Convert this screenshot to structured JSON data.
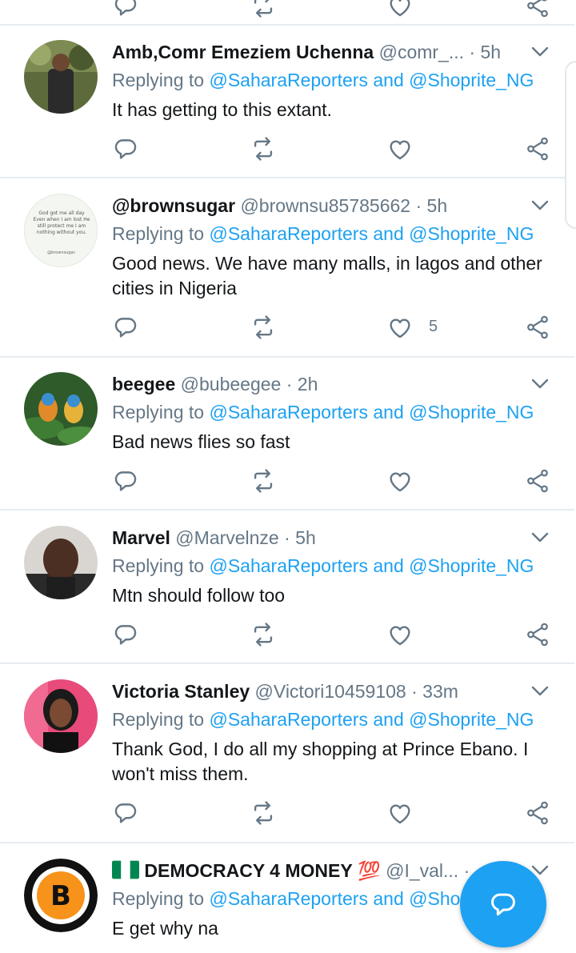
{
  "reply_prefix": "Replying to",
  "and_word": "and",
  "tweets": [
    {
      "name": "Amb,Comr Emeziem Uchenna",
      "handle": "@comr_...",
      "time": "5h",
      "mention1": "@SaharaReporters",
      "mention2": "@Shoprite_NG",
      "text": "It has getting  to this extant.",
      "like_count": ""
    },
    {
      "name": "@brownsugar",
      "handle": "@brownsu85785662",
      "time": "5h",
      "mention1": "@SaharaReporters",
      "mention2": "@Shoprite_NG",
      "text": "Good news.  We have many malls, in lagos and other cities in Nigeria",
      "like_count": "5",
      "avatar_text": "God got me all day Even when I am lost He still protect me I am nothing without you.",
      "avatar_signature": "@brownsugar."
    },
    {
      "name": "beegee",
      "handle": "@bubeegee",
      "time": "2h",
      "mention1": "@SaharaReporters",
      "mention2": "@Shoprite_NG",
      "text": "Bad news flies so fast",
      "like_count": ""
    },
    {
      "name": "Marvel",
      "handle": "@Marvelnze",
      "time": "5h",
      "mention1": "@SaharaReporters",
      "mention2": "@Shoprite_NG",
      "text": "Mtn should follow too",
      "like_count": ""
    },
    {
      "name": "Victoria Stanley",
      "handle": "@Victori10459108",
      "time": "33m",
      "mention1": "@SaharaReporters",
      "mention2": "@Shoprite_NG",
      "text": "Thank God, I do all my shopping at Prince Ebano. I won't miss them.",
      "like_count": ""
    },
    {
      "name": "DEMOCRACY 4 MONEY",
      "name_emoji_flag": "nigeria-flag-icon",
      "name_emoji_100": "💯",
      "handle": "@I_val...",
      "time": "",
      "mention1": "@SaharaReporters",
      "mention2": "@Sho",
      "text": "E get why na",
      "like_count": ""
    }
  ],
  "colors": {
    "accent": "#1da1f2",
    "muted": "#657786",
    "text": "#14171a",
    "divider": "#e6ecf0"
  },
  "icons": [
    "reply-icon",
    "retweet-icon",
    "like-icon",
    "share-icon",
    "chevron-down-icon",
    "compose-reply-icon"
  ]
}
